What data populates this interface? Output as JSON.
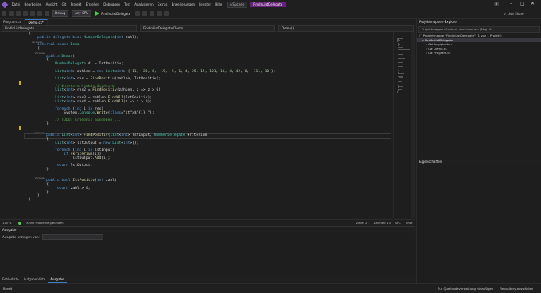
{
  "menu": {
    "items": [
      "Datei",
      "Bearbeiten",
      "Ansicht",
      "Git",
      "Projekt",
      "Erstellen",
      "Debuggen",
      "Test",
      "Analysieren",
      "Extras",
      "Erweiterungen",
      "Fenster",
      "Hilfe"
    ],
    "search": "Suchen",
    "title": "FindInListDelegate",
    "avatar": "U",
    "colors": {
      "title_badge": "#68217a",
      "accent": "#3e7ac5"
    }
  },
  "toolbar": {
    "config": "Debug",
    "platform": "Any CPU",
    "run_label": "FindInListDelegate",
    "live_share": "Live Share"
  },
  "tabs": [
    {
      "label": "Program.cs",
      "active": false
    },
    {
      "label": "Demo.cs*",
      "active": true
    }
  ],
  "nav": {
    "project": "FindInListDelegate",
    "class": "FindInListDelegate.Demo",
    "member": "Demo()"
  },
  "code_lines": [
    "{",
    "    public delegate bool NumberDelegate(int zahl);",
    "    Verweise",
    "    internal class Demo",
    "    {",
    "        Verweise",
    "        public Demo()",
    "        {",
    "            NumberDelegate dl = IstPositiv;",
    "",
    "            List<int> zahlen = new List<int> { 11, -20, 6, -19, -5, 1, 4, 25, 15, 101, 16, 4, 42, 0, -111, 10 };",
    "",
    "            List<int> res = FindPositiv(zahlen, IstPositiv);",
    "",
    "            // Kurzform Lambda-Ausdruck",
    "            List<int> res2 = FindPositiv(zahlen, z => z > 0);",
    "",
    "            List<int> res3 = zahlen.FindAll(IstPositiv);",
    "            List<int> res4 = zahlen.FindAll(z => z > 0);",
    "",
    "            foreach (int i in res)",
    "                System.Console.Write($\"{i} \");",
    "",
    "            // TODO: Ergebnis ausgeben ...",
    "        }",
    "",
    "        Verweise",
    "        public List<int> FindPositiv(List<int> lstInput, NumberDelegate kriterium)",
    "        {",
    "            List<int> lstOutput = new List<int>();",
    "",
    "            foreach (int i in lstInput)",
    "                if (kriterium(i))",
    "                    lstOutput.Add(i);",
    "",
    "            return lstOutput;",
    "        }",
    "",
    "        Verweise",
    "        public bool IstPositiv(int zahl)",
    "        {",
    "            return zahl > 0;",
    "        }",
    "    }",
    "}",
    "",
    "",
    ""
  ],
  "editor_status": {
    "zoom": "110 %",
    "problems": "Keine Probleme gefunden",
    "line": "Zeile: 21",
    "char": "Zeichen: 13",
    "mode": "SPC",
    "eol": "CRLF"
  },
  "output": {
    "title": "Ausgabe",
    "show_from": "Ausgabe anzeigen von:"
  },
  "bottom_tabs": [
    {
      "label": "Fehlerliste",
      "active": false
    },
    {
      "label": "Aufgabenliste",
      "active": false
    },
    {
      "label": "Ausgabe",
      "active": true
    }
  ],
  "solution_explorer": {
    "title": "Projektmappen-Explorer",
    "search": "Projektmappen-Explorer durchsuchen (Strg+ü)",
    "items": [
      {
        "label": "Projektmappe \"FindInListDelegate\" (1 von 1 Projekt)",
        "indent": 0,
        "selected": false
      },
      {
        "label": "FindInListDelegate",
        "indent": 1,
        "selected": true
      },
      {
        "label": "Abhängigkeiten",
        "indent": 2,
        "selected": false
      },
      {
        "label": "C# Demo.cs",
        "indent": 2,
        "selected": false
      },
      {
        "label": "C# Program.cs",
        "indent": 2,
        "selected": false
      }
    ]
  },
  "properties": {
    "title": "Eigenschaften"
  },
  "statusbar": {
    "ready": "Bereit",
    "source_control": "Zur Quellcodeverwaltung hinzufügen",
    "repo": "Repository auswählen"
  }
}
